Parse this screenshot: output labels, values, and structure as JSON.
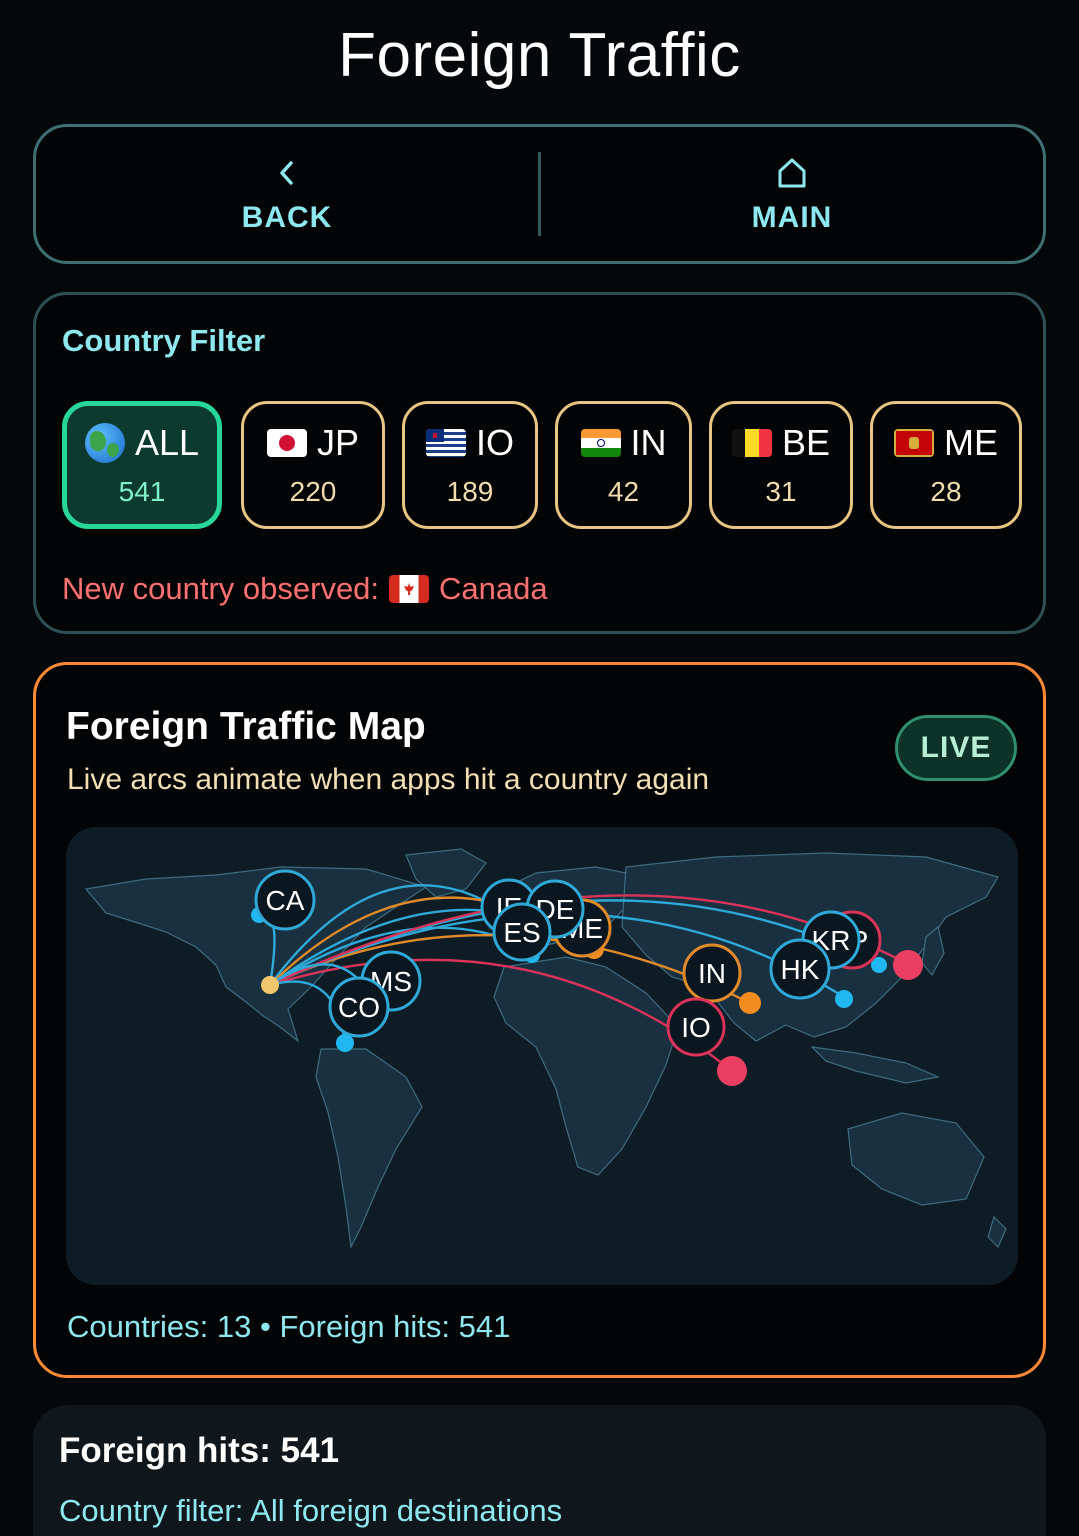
{
  "header": {
    "title": "Foreign Traffic"
  },
  "nav": {
    "back_label": "BACK",
    "main_label": "MAIN",
    "back_icon": "chevron-left-icon",
    "main_icon": "home-icon"
  },
  "filter": {
    "title": "Country Filter",
    "chips": [
      {
        "code": "ALL",
        "count": "541",
        "icon": "globe-icon",
        "selected": true
      },
      {
        "code": "JP",
        "count": "220",
        "icon": "flag-jp"
      },
      {
        "code": "IO",
        "count": "189",
        "icon": "flag-io"
      },
      {
        "code": "IN",
        "count": "42",
        "icon": "flag-in"
      },
      {
        "code": "BE",
        "count": "31",
        "icon": "flag-be"
      },
      {
        "code": "ME",
        "count": "28",
        "icon": "flag-me"
      }
    ],
    "new_country_prefix": "New country observed:",
    "new_country_name": "Canada"
  },
  "map": {
    "title": "Foreign Traffic Map",
    "subtitle": "Live arcs animate when apps hit a country again",
    "live_label": "LIVE",
    "stats": "Countries: 13 • Foreign hits: 541",
    "node_labels": [
      "CA",
      "MS",
      "CO",
      "IE",
      "DE",
      "ES",
      "ME",
      "IN",
      "IO",
      "HK",
      "KR",
      "JP"
    ]
  },
  "summary": {
    "hits": "Foreign hits: 541",
    "filter": "Country filter: All foreign destinations"
  },
  "colors": {
    "accent_cyan": "#8ee8f0",
    "accent_orange": "#ff8a36",
    "accent_green": "#29d69a",
    "chip_border": "#e9c583",
    "alert_red": "#ff7070"
  }
}
